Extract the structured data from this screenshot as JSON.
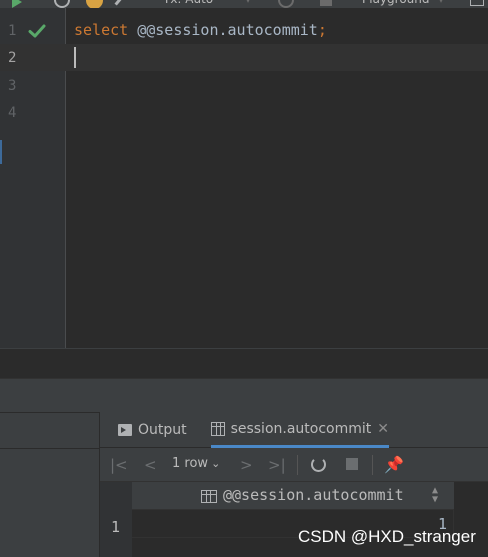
{
  "toolbar": {
    "tx_mode": "Tx: Auto",
    "console_name": "Playground"
  },
  "editor": {
    "line_numbers": [
      "1",
      "2",
      "3",
      "4"
    ],
    "code_keyword": "select",
    "code_expression": "@@session.autocommit",
    "code_terminator": ";",
    "line1_status": "check-icon"
  },
  "services": {
    "tabs": {
      "output_label": "Output",
      "result_label": "session.autocommit"
    },
    "nav": {
      "rows_label": "1 row"
    },
    "grid": {
      "columns": [
        "@@session.autocommit"
      ],
      "rows": [
        {
          "num": "1",
          "values": [
            "1"
          ]
        }
      ]
    }
  },
  "watermark": "CSDN @HXD_stranger",
  "colors": {
    "keyword": "#cc7832",
    "check": "#59a869",
    "tab_underline": "#4a88c7"
  }
}
